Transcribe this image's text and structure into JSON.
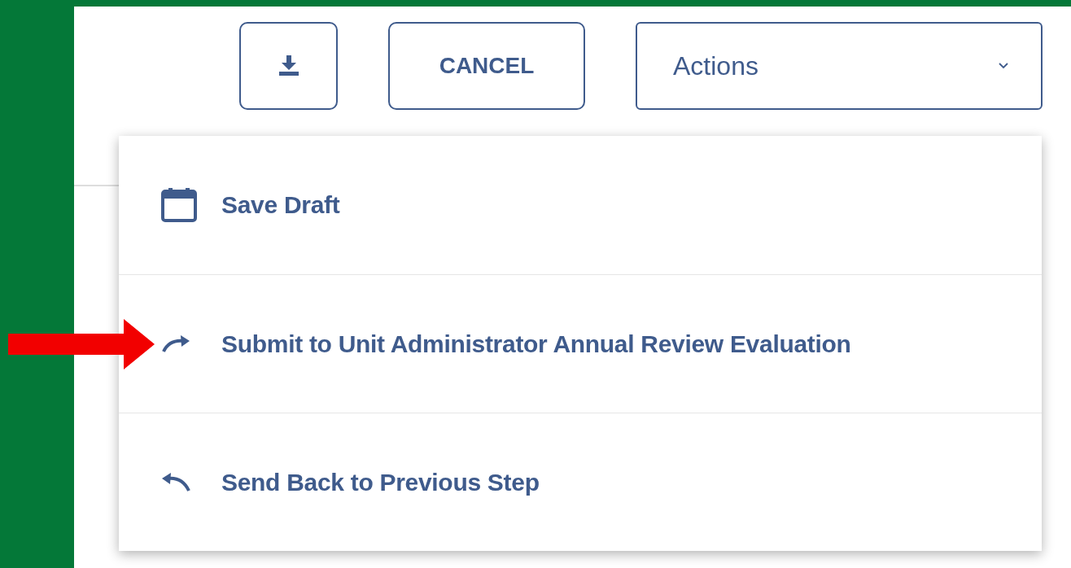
{
  "toolbar": {
    "cancel_button": "CANCEL",
    "actions_select": {
      "value": "Actions",
      "expanded": true
    }
  },
  "actions_menu": [
    {
      "kind": "save",
      "label": "Save Draft"
    },
    {
      "kind": "forward",
      "label": "Submit to Unit Administrator Annual Review Evaluation"
    },
    {
      "kind": "back",
      "label": "Send Back to Previous Step"
    }
  ]
}
